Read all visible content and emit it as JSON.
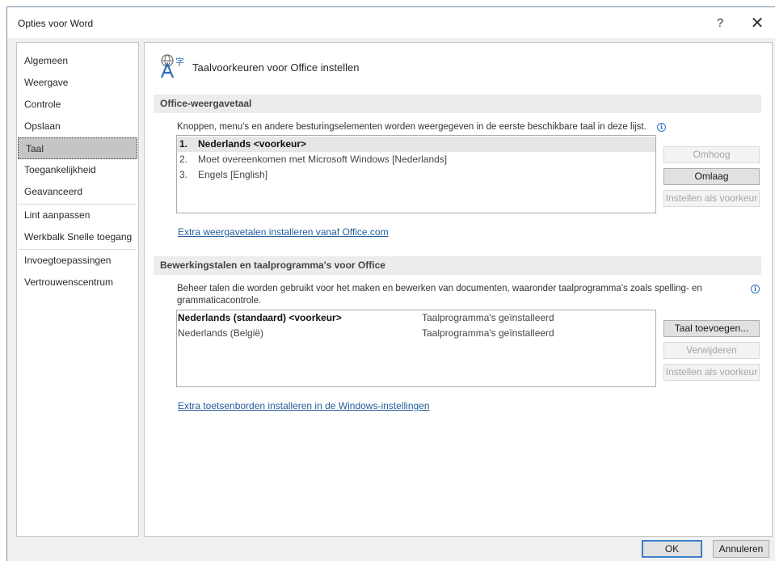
{
  "window": {
    "title": "Opties voor Word",
    "help_glyph": "?",
    "close_glyph": "✕"
  },
  "sidebar": {
    "items": [
      {
        "label": "Algemeen"
      },
      {
        "label": "Weergave"
      },
      {
        "label": "Controle"
      },
      {
        "label": "Opslaan"
      },
      {
        "label": "Taal",
        "selected": true
      },
      {
        "label": "Toegankelijkheid"
      },
      {
        "label": "Geavanceerd"
      },
      {
        "label": "Lint aanpassen"
      },
      {
        "label": "Werkbalk Snelle toegang"
      },
      {
        "label": "Invoegtoepassingen"
      },
      {
        "label": "Vertrouwenscentrum"
      }
    ]
  },
  "header": {
    "icon": "language-icon",
    "title": "Taalvoorkeuren voor Office instellen"
  },
  "display_language": {
    "section_title": "Office-weergavetaal",
    "description": "Knoppen, menu's en andere besturingselementen worden weergegeven in de eerste beschikbare taal in deze lijst.",
    "items": [
      {
        "num": "1.",
        "label": "Nederlands <voorkeur>",
        "selected": true
      },
      {
        "num": "2.",
        "label": "Moet overeenkomen met Microsoft Windows [Nederlands]"
      },
      {
        "num": "3.",
        "label": "Engels [English]"
      }
    ],
    "buttons": {
      "up": "Omhoog",
      "down": "Omlaag",
      "set_preferred": "Instellen als voorkeur"
    },
    "link": "Extra weergavetalen installeren vanaf Office.com"
  },
  "editing_languages": {
    "section_title": "Bewerkingstalen en taalprogramma's voor Office",
    "description_line1": "Beheer talen die worden gebruikt voor het maken en bewerken van documenten, waaronder taalprogramma's zoals spelling- en",
    "description_line2": "grammaticacontrole.",
    "rows": [
      {
        "language": "Nederlands (standaard) <voorkeur>",
        "status": "Taalprogramma's geïnstalleerd",
        "selected": true
      },
      {
        "language": "Nederlands (België)",
        "status": "Taalprogramma's geïnstalleerd"
      }
    ],
    "buttons": {
      "add": "Taal toevoegen...",
      "remove": "Verwijderen",
      "set_preferred": "Instellen als voorkeur"
    },
    "link": "Extra toetsenborden installeren in de Windows-instellingen"
  },
  "footer": {
    "ok": "OK",
    "cancel": "Annuleren"
  },
  "colors": {
    "accent": "#3c7fcb",
    "link": "#245e9e",
    "selection": "#c5c5c5"
  }
}
